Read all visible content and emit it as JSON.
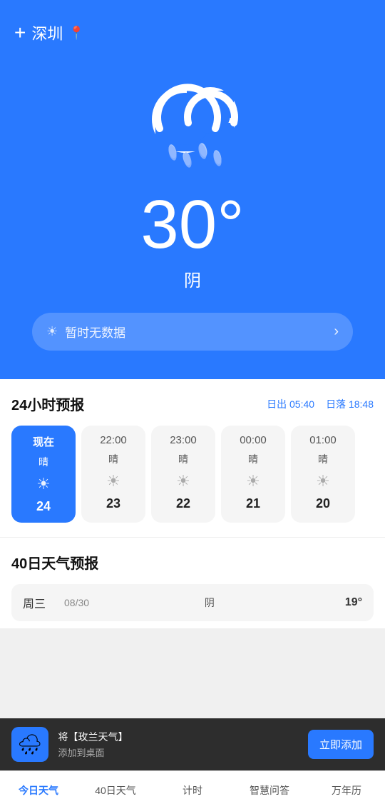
{
  "header": {
    "add_icon": "+",
    "city": "深圳",
    "location_icon": "📍"
  },
  "hero": {
    "temperature": "30°",
    "description": "阴",
    "no_data_text": "暂时无数据",
    "arrow": "›"
  },
  "forecast_24h": {
    "title": "24小时预报",
    "sunrise": "日出 05:40",
    "sunset": "日落 18:48",
    "hours": [
      {
        "time": "现在",
        "condition": "晴",
        "icon": "☀",
        "temp": "24",
        "active": true
      },
      {
        "time": "22:00",
        "condition": "晴",
        "icon": "☀",
        "temp": "23",
        "active": false
      },
      {
        "time": "23:00",
        "condition": "晴",
        "icon": "☀",
        "temp": "22",
        "active": false
      },
      {
        "time": "00:00",
        "condition": "晴",
        "icon": "☀",
        "temp": "21",
        "active": false
      },
      {
        "time": "01:00",
        "condition": "晴",
        "icon": "☀",
        "temp": "20",
        "active": false
      }
    ]
  },
  "forecast_40d": {
    "title": "40日天气预报",
    "preview_day": "周三",
    "preview_date": "08/30",
    "preview_condition": "阴",
    "preview_temp": "19°"
  },
  "toast": {
    "icon": "🌧",
    "line1": "将【玫兰天气】",
    "line2": "添加到桌面",
    "button": "立即添加"
  },
  "bottom_nav": {
    "items": [
      "今日天气",
      "40日天气",
      "计时",
      "智慧问答",
      "万年历"
    ],
    "active_index": 0
  }
}
